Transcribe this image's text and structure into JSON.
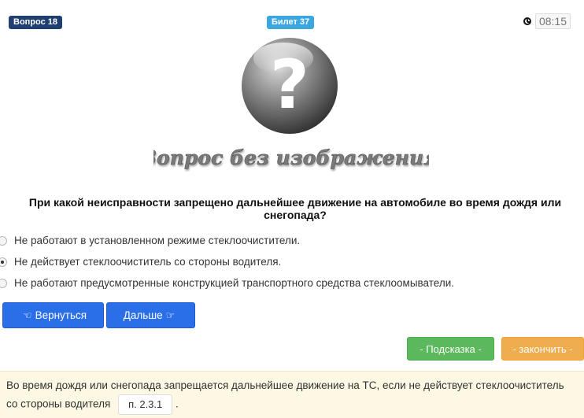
{
  "header": {
    "question_badge": "Вопрос 18",
    "ticket_badge": "Билет 37",
    "timer": "08:15",
    "timer_icon": "clock-icon"
  },
  "image": {
    "icon": "question-mark-icon",
    "caption": "Вопрос без изображения"
  },
  "question": {
    "text": "При какой неисправности запрещено дальнейшее движение на автомобиле во время дождя или снегопада?"
  },
  "answers": [
    {
      "text": "Не работают в установленном режиме стеклоочистители.",
      "selected": false
    },
    {
      "text": "Не действует стеклоочиститель со стороны водителя.",
      "selected": true
    },
    {
      "text": "Не работают предусмотренные конструкцией транспортного средства стеклоомыватели.",
      "selected": false
    }
  ],
  "buttons": {
    "back_label": "Вернуться",
    "back_icon": "hand-left-icon",
    "next_label": "Дальше",
    "next_icon": "hand-right-icon",
    "hint_label": "- Подсказка -",
    "finish_label": "- закончить -"
  },
  "hint": {
    "text": "Во время дождя или снегопада запрещается дальнейшее движение на ТС, если не действует стеклоочиститель со стороны водителя",
    "reference": "п. 2.3.1",
    "suffix": "."
  },
  "colors": {
    "badge_question": "#1f3f73",
    "badge_ticket": "#3ba6e0",
    "primary": "#2b6fe8",
    "success": "#5cb85c",
    "warning": "#f0ad4e",
    "hint_bg": "#fcf8e3"
  }
}
